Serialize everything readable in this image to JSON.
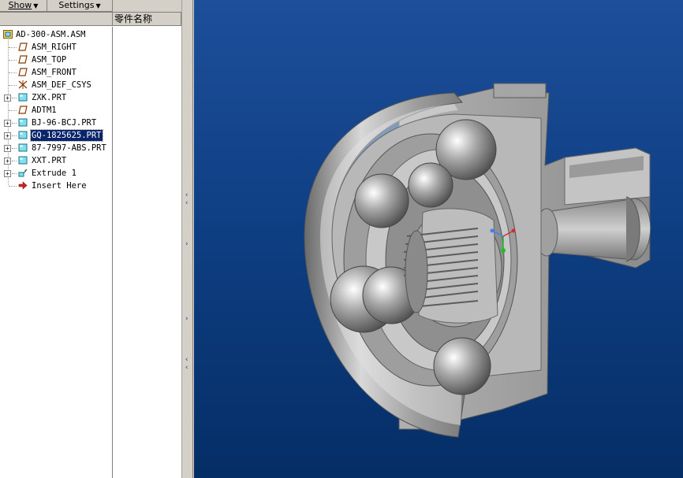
{
  "toolbar": {
    "show_label": "Show",
    "settings_label": "Settings"
  },
  "columns": {
    "tree_header": "",
    "name_header": "零件名称"
  },
  "tree": {
    "root": "AD-300-ASM.ASM",
    "items": [
      {
        "label": "ASM_RIGHT",
        "icon": "datum-plane-icon",
        "expandable": false
      },
      {
        "label": "ASM_TOP",
        "icon": "datum-plane-icon",
        "expandable": false
      },
      {
        "label": "ASM_FRONT",
        "icon": "datum-plane-icon",
        "expandable": false
      },
      {
        "label": "ASM_DEF_CSYS",
        "icon": "coordinate-system-icon",
        "expandable": false
      },
      {
        "label": "ZXK.PRT",
        "icon": "part-icon",
        "expandable": true
      },
      {
        "label": "ADTM1",
        "icon": "datum-plane-icon",
        "expandable": false
      },
      {
        "label": "BJ-96-BCJ.PRT",
        "icon": "part-icon",
        "expandable": true
      },
      {
        "label": "GQ-1825625.PRT",
        "icon": "part-icon",
        "expandable": true,
        "selected": true
      },
      {
        "label": "87-7997-ABS.PRT",
        "icon": "part-icon",
        "expandable": true
      },
      {
        "label": "XXT.PRT",
        "icon": "part-icon",
        "expandable": true
      },
      {
        "label": "Extrude 1",
        "icon": "extrude-icon",
        "expandable": true
      },
      {
        "label": "Insert Here",
        "icon": "insert-arrow-icon",
        "expandable": false
      }
    ]
  },
  "viewport": {
    "model": "cv-joint-assembly-section",
    "background_top": "#1d4f9a",
    "background_bottom": "#052e66",
    "triad_colors": {
      "x": "#d03030",
      "y": "#20c020",
      "z": "#4080ff"
    }
  }
}
